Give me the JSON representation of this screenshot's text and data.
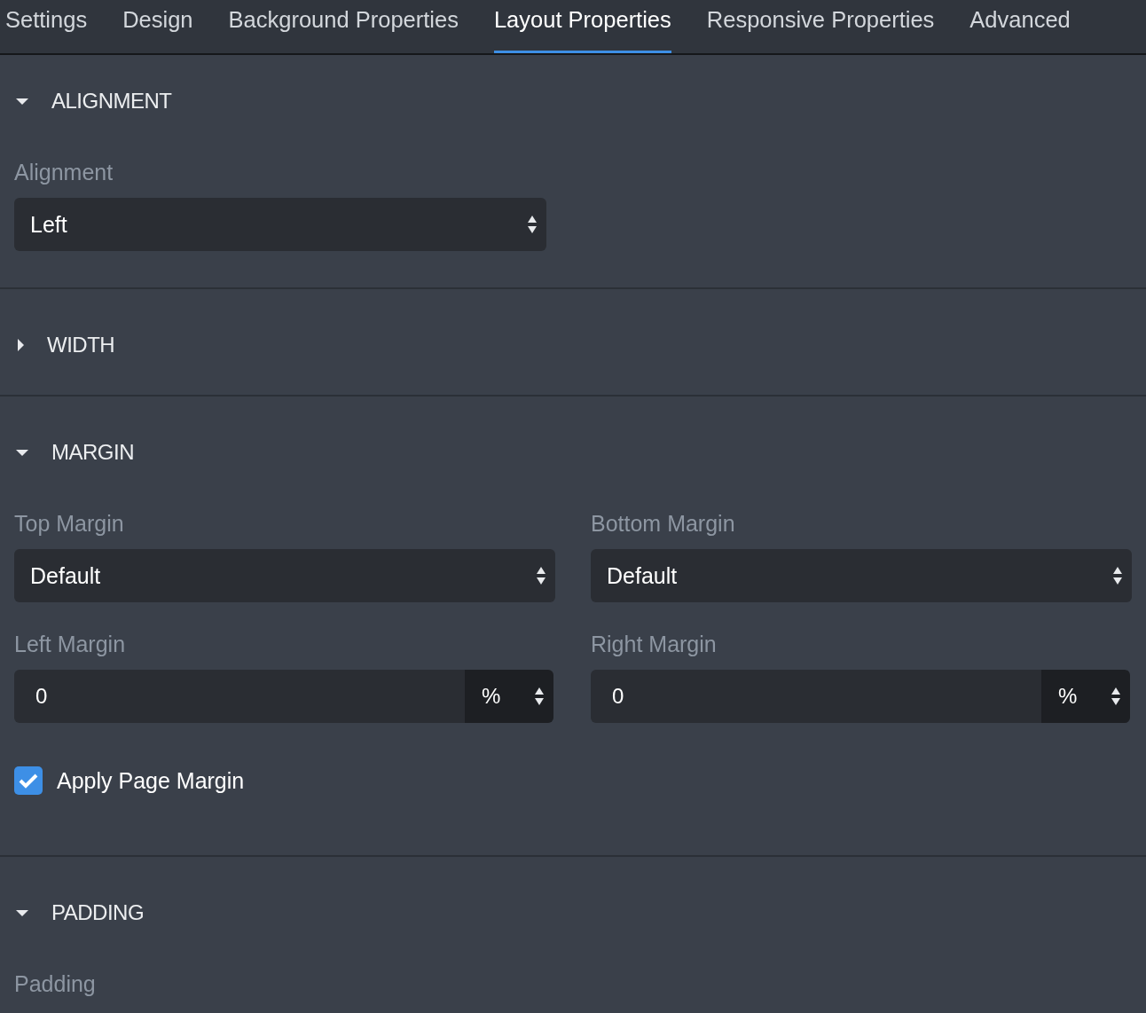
{
  "tabs": [
    {
      "label": "Settings",
      "selected": false
    },
    {
      "label": "Design",
      "selected": false
    },
    {
      "label": "Background Properties",
      "selected": false
    },
    {
      "label": "Layout Properties",
      "selected": true
    },
    {
      "label": "Responsive Properties",
      "selected": false
    },
    {
      "label": "Advanced",
      "selected": false
    }
  ],
  "sections": [
    {
      "title": "ALIGNMENT",
      "expanded": true,
      "fields": [
        {
          "kind": "select",
          "label": "Alignment",
          "value": "Left"
        }
      ]
    },
    {
      "title": "WIDTH",
      "expanded": false
    },
    {
      "title": "MARGIN",
      "expanded": true,
      "fields": [
        {
          "kind": "select",
          "label": "Top Margin",
          "value": "Default"
        },
        {
          "kind": "select",
          "label": "Bottom Margin",
          "value": "Default"
        },
        {
          "kind": "unit",
          "label": "Left Margin",
          "value": "0",
          "unit": "%"
        },
        {
          "kind": "unit",
          "label": "Right Margin",
          "value": "0",
          "unit": "%"
        }
      ],
      "checkbox": {
        "label": "Apply Page Margin",
        "checked": true
      }
    },
    {
      "title": "PADDING",
      "expanded": true,
      "fields": [
        {
          "kind": "label",
          "label": "Padding"
        }
      ]
    }
  ]
}
